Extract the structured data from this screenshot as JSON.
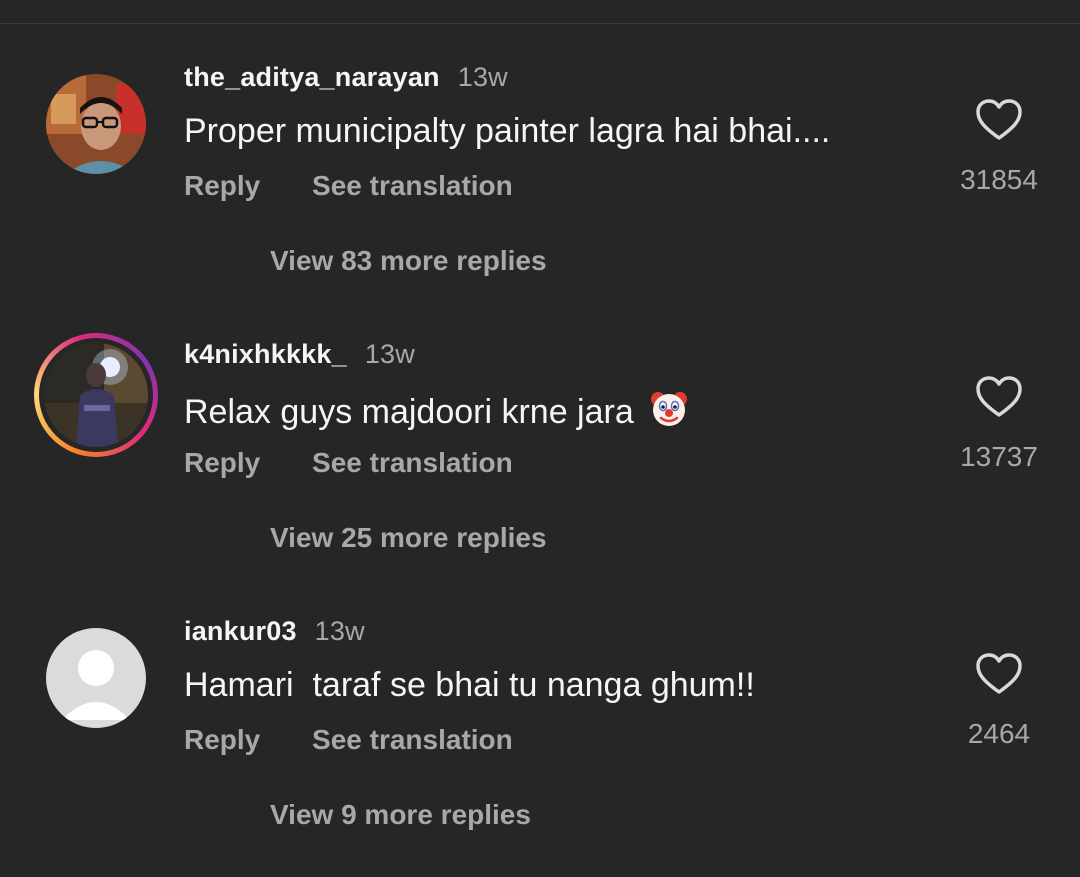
{
  "comments": [
    {
      "username": "the_aditya_narayan",
      "time": "13w",
      "text": "Proper municipalty painter lagra hai bhai....",
      "reply_label": "Reply",
      "translate_label": "See translation",
      "likes": "31854",
      "view_replies": "View 83 more replies"
    },
    {
      "username": "k4nixhkkkk_",
      "time": "13w",
      "text": "Relax guys majdoori krne jara",
      "reply_label": "Reply",
      "translate_label": "See translation",
      "likes": "13737",
      "view_replies": "View 25 more replies"
    },
    {
      "username": "iankur03",
      "time": "13w",
      "text": "Hamari  taraf se bhai tu nanga ghum!!",
      "reply_label": "Reply",
      "translate_label": "See translation",
      "likes": "2464",
      "view_replies": "View 9 more replies"
    }
  ]
}
